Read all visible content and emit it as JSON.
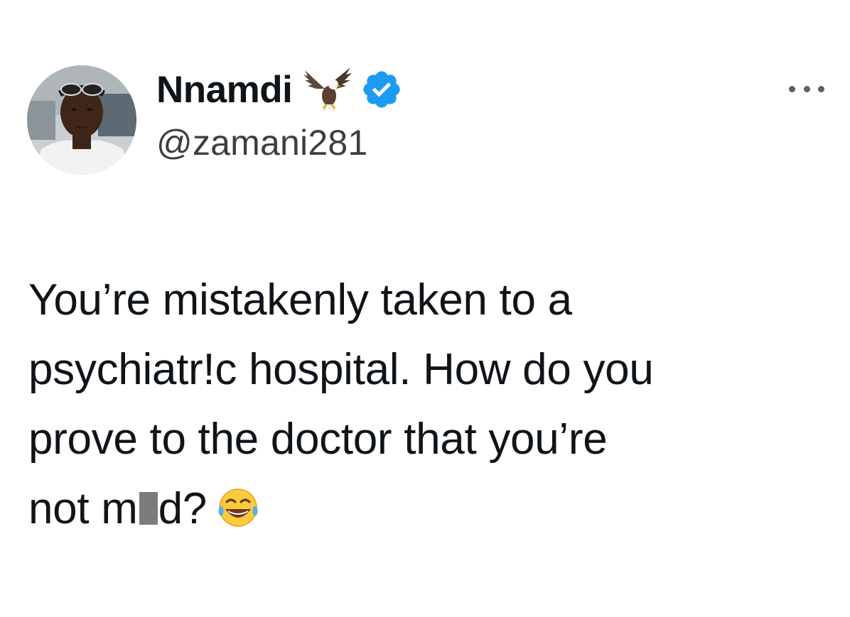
{
  "author": {
    "display_name": "Nnamdi",
    "handle": "@zamani281",
    "name_emoji": "eagle-icon",
    "verified": true,
    "verified_color": "#1d9bf0"
  },
  "menu": {
    "icon": "more-icon"
  },
  "tweet": {
    "line1": "You’re mistakenly taken to a",
    "line2": "psychiatr!c hospital. How do you",
    "line3": "prove to the doctor that you’re",
    "line4_before": "not m",
    "line4_after": "d?",
    "trailing_emoji": "face-with-tears-of-joy-icon"
  }
}
